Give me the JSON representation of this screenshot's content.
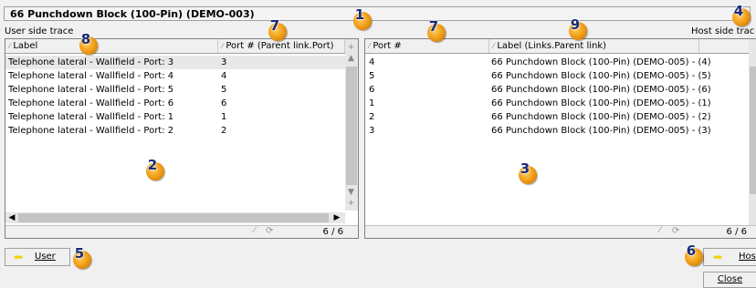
{
  "title": "66 Punchdown Block (100-Pin) (DEMO-003)",
  "user_side": {
    "label": "User side trace",
    "columns": [
      "Label",
      "Port # (Parent link.Port)"
    ],
    "rows": [
      {
        "label": "Telephone lateral - Wallfield - Port: 3",
        "port": "3"
      },
      {
        "label": "Telephone lateral - Wallfield - Port: 4",
        "port": "4"
      },
      {
        "label": "Telephone lateral - Wallfield - Port: 5",
        "port": "5"
      },
      {
        "label": "Telephone lateral - Wallfield - Port: 6",
        "port": "6"
      },
      {
        "label": "Telephone lateral - Wallfield - Port: 1",
        "port": "1"
      },
      {
        "label": "Telephone lateral - Wallfield - Port: 2",
        "port": "2"
      }
    ],
    "pager": "6 / 6"
  },
  "host_side": {
    "label": "Host side trac",
    "columns": [
      "Port #",
      "Label (Links.Parent link)"
    ],
    "rows": [
      {
        "port": "4",
        "label": "66 Punchdown Block (100-Pin) (DEMO-005) - (4)"
      },
      {
        "port": "5",
        "label": "66 Punchdown Block (100-Pin) (DEMO-005) - (5)"
      },
      {
        "port": "6",
        "label": "66 Punchdown Block (100-Pin) (DEMO-005) - (6)"
      },
      {
        "port": "1",
        "label": "66 Punchdown Block (100-Pin) (DEMO-005) - (1)"
      },
      {
        "port": "2",
        "label": "66 Punchdown Block (100-Pin) (DEMO-005) - (2)"
      },
      {
        "port": "3",
        "label": "66 Punchdown Block (100-Pin) (DEMO-005) - (3)"
      }
    ],
    "pager": "6 / 6"
  },
  "buttons": {
    "user": "User",
    "host": "Hos",
    "close": "Close"
  },
  "callouts": [
    "1",
    "2",
    "3",
    "4",
    "5",
    "6",
    "7",
    "7",
    "8",
    "9"
  ],
  "colors": {
    "callout": "#f2a21a",
    "callout_text": "#1a2a7a",
    "arrow": "#f0d000"
  }
}
